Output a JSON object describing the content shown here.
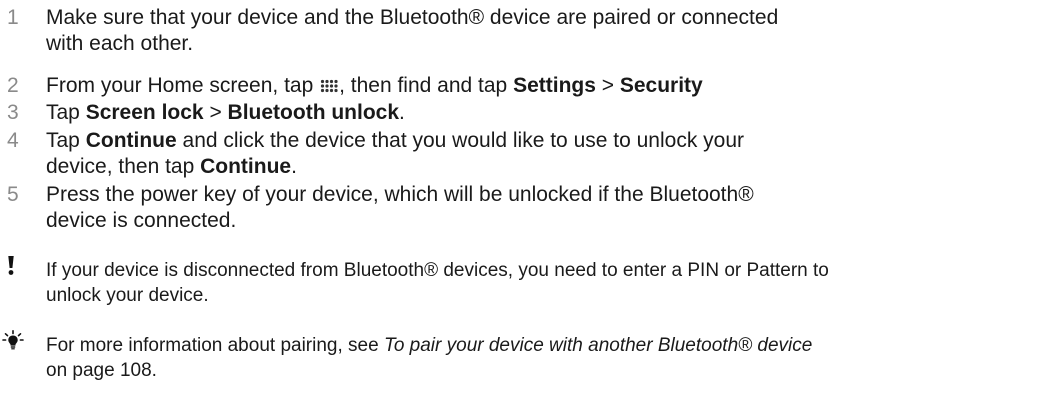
{
  "steps": [
    {
      "num": "1",
      "line1": "Make sure that your device and the Bluetooth® device are paired or connected",
      "line2": "with each other."
    },
    {
      "num": "2",
      "pre": "From your Home screen, tap ",
      "mid": ", then find and tap ",
      "b1": "Settings",
      "sep": " > ",
      "b2": "Security"
    },
    {
      "num": "3",
      "pre": "Tap ",
      "b1": "Screen lock",
      "sep": " > ",
      "b2": "Bluetooth unlock",
      "post": "."
    },
    {
      "num": "4",
      "pre": "Tap ",
      "b1": "Continue",
      "mid": " and click the device that you would like to use to unlock your",
      "line2_pre": "device, then tap ",
      "b2": "Continue",
      "post": "."
    },
    {
      "num": "5",
      "line1": "Press the power key of your device, which will be unlocked if the Bluetooth®",
      "line2": "device is connected."
    }
  ],
  "warning": {
    "icon": "exclamation-icon",
    "line1": "If your device is disconnected from Bluetooth® devices, you need to enter a PIN or Pattern to",
    "line2": "unlock your device."
  },
  "tip": {
    "icon": "lightbulb-icon",
    "pre": "For more information about pairing, see ",
    "link": "To pair your device with another Bluetooth® device",
    "post": "on page 108."
  }
}
